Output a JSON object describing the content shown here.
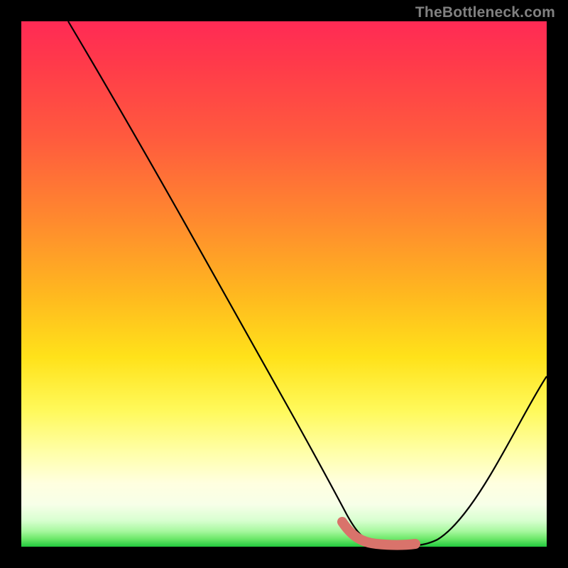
{
  "watermark": "TheBottleneck.com",
  "chart_data": {
    "type": "line",
    "title": "",
    "xlabel": "",
    "ylabel": "",
    "xlim": [
      0,
      100
    ],
    "ylim": [
      0,
      100
    ],
    "series": [
      {
        "name": "bottleneck-curve",
        "x": [
          9,
          15,
          22,
          30,
          38,
          46,
          52,
          57,
          61,
          64,
          67,
          71,
          75,
          80,
          86,
          92,
          100
        ],
        "values": [
          100,
          90,
          78,
          64,
          50,
          36,
          25,
          15,
          8,
          3,
          1,
          0,
          0,
          2,
          8,
          18,
          32
        ]
      }
    ],
    "highlight_segment": {
      "name": "optimal-range",
      "x_start": 61,
      "x_end": 75,
      "color": "#d9736b"
    },
    "gradient_stops": [
      {
        "pos": 0,
        "color": "#ff2a55"
      },
      {
        "pos": 0.5,
        "color": "#ffb81f"
      },
      {
        "pos": 0.75,
        "color": "#fff95a"
      },
      {
        "pos": 0.97,
        "color": "#a8f8a0"
      },
      {
        "pos": 1.0,
        "color": "#22c93e"
      }
    ]
  }
}
